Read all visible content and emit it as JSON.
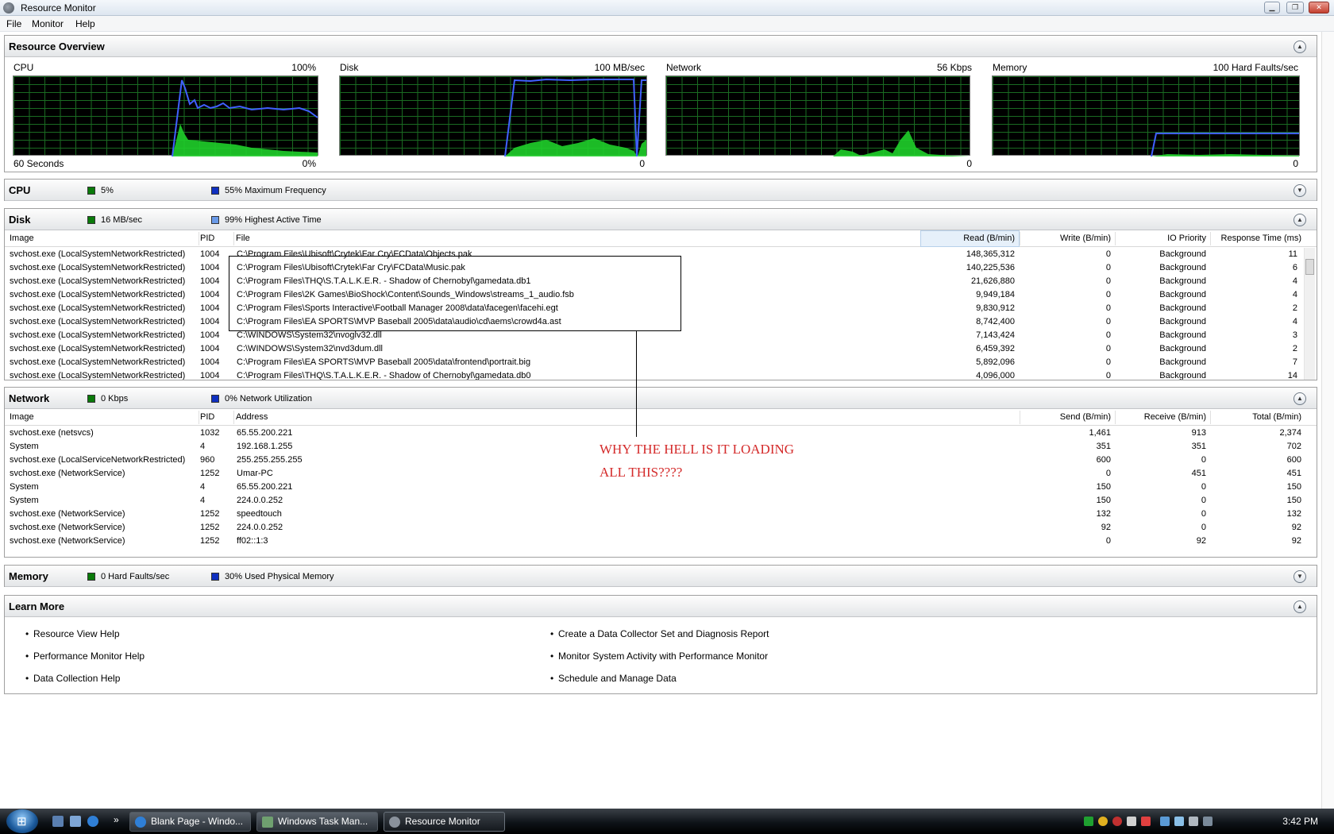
{
  "window": {
    "title": "Resource Monitor"
  },
  "menu": [
    "File",
    "Monitor",
    "Help"
  ],
  "overview": {
    "title": "Resource Overview",
    "graphs": [
      {
        "name": "CPU",
        "max": "100%",
        "min": "0%",
        "time": "60 Seconds"
      },
      {
        "name": "Disk",
        "max": "100 MB/sec",
        "min": "0"
      },
      {
        "name": "Network",
        "max": "56 Kbps",
        "min": "0"
      },
      {
        "name": "Memory",
        "max": "100 Hard Faults/sec",
        "min": "0"
      }
    ]
  },
  "cpu": {
    "title": "CPU",
    "ind1": "5%",
    "ind2": "55% Maximum Frequency"
  },
  "disk": {
    "title": "Disk",
    "ind1": "16 MB/sec",
    "ind2": "99% Highest Active Time",
    "columns": {
      "image": "Image",
      "pid": "PID",
      "file": "File",
      "read": "Read (B/min)",
      "write": "Write (B/min)",
      "io": "IO Priority",
      "resp": "Response Time (ms)"
    },
    "rows": [
      {
        "image": "svchost.exe (LocalSystemNetworkRestricted)",
        "pid": "1004",
        "file": "C:\\Program Files\\Ubisoft\\Crytek\\Far Cry\\FCData\\Objects.pak",
        "read": "148,365,312",
        "write": "0",
        "io": "Background",
        "resp": "11"
      },
      {
        "image": "svchost.exe (LocalSystemNetworkRestricted)",
        "pid": "1004",
        "file": "C:\\Program Files\\Ubisoft\\Crytek\\Far Cry\\FCData\\Music.pak",
        "read": "140,225,536",
        "write": "0",
        "io": "Background",
        "resp": "6"
      },
      {
        "image": "svchost.exe (LocalSystemNetworkRestricted)",
        "pid": "1004",
        "file": "C:\\Program Files\\THQ\\S.T.A.L.K.E.R. - Shadow of Chernobyl\\gamedata.db1",
        "read": "21,626,880",
        "write": "0",
        "io": "Background",
        "resp": "4"
      },
      {
        "image": "svchost.exe (LocalSystemNetworkRestricted)",
        "pid": "1004",
        "file": "C:\\Program Files\\2K Games\\BioShock\\Content\\Sounds_Windows\\streams_1_audio.fsb",
        "read": "9,949,184",
        "write": "0",
        "io": "Background",
        "resp": "4"
      },
      {
        "image": "svchost.exe (LocalSystemNetworkRestricted)",
        "pid": "1004",
        "file": "C:\\Program Files\\Sports Interactive\\Football Manager 2008\\data\\facegen\\facehi.egt",
        "read": "9,830,912",
        "write": "0",
        "io": "Background",
        "resp": "2"
      },
      {
        "image": "svchost.exe (LocalSystemNetworkRestricted)",
        "pid": "1004",
        "file": "C:\\Program Files\\EA SPORTS\\MVP Baseball 2005\\data\\audio\\cd\\aems\\crowd4a.ast",
        "read": "8,742,400",
        "write": "0",
        "io": "Background",
        "resp": "4"
      },
      {
        "image": "svchost.exe (LocalSystemNetworkRestricted)",
        "pid": "1004",
        "file": "C:\\WINDOWS\\System32\\nvoglv32.dll",
        "read": "7,143,424",
        "write": "0",
        "io": "Background",
        "resp": "3"
      },
      {
        "image": "svchost.exe (LocalSystemNetworkRestricted)",
        "pid": "1004",
        "file": "C:\\WINDOWS\\System32\\nvd3dum.dll",
        "read": "6,459,392",
        "write": "0",
        "io": "Background",
        "resp": "2"
      },
      {
        "image": "svchost.exe (LocalSystemNetworkRestricted)",
        "pid": "1004",
        "file": "C:\\Program Files\\EA SPORTS\\MVP Baseball 2005\\data\\frontend\\portrait.big",
        "read": "5,892,096",
        "write": "0",
        "io": "Background",
        "resp": "7"
      },
      {
        "image": "svchost.exe (LocalSystemNetworkRestricted)",
        "pid": "1004",
        "file": "C:\\Program Files\\THQ\\S.T.A.L.K.E.R. - Shadow of Chernobyl\\gamedata.db0",
        "read": "4,096,000",
        "write": "0",
        "io": "Background",
        "resp": "14"
      }
    ]
  },
  "network": {
    "title": "Network",
    "ind1": "0 Kbps",
    "ind2": "0% Network Utilization",
    "columns": {
      "image": "Image",
      "pid": "PID",
      "address": "Address",
      "send": "Send (B/min)",
      "receive": "Receive (B/min)",
      "total": "Total (B/min)"
    },
    "rows": [
      {
        "image": "svchost.exe (netsvcs)",
        "pid": "1032",
        "address": "65.55.200.221",
        "send": "1,461",
        "receive": "913",
        "total": "2,374"
      },
      {
        "image": "System",
        "pid": "4",
        "address": "192.168.1.255",
        "send": "351",
        "receive": "351",
        "total": "702"
      },
      {
        "image": "svchost.exe (LocalServiceNetworkRestricted)",
        "pid": "960",
        "address": "255.255.255.255",
        "send": "600",
        "receive": "0",
        "total": "600"
      },
      {
        "image": "svchost.exe (NetworkService)",
        "pid": "1252",
        "address": "Umar-PC",
        "send": "0",
        "receive": "451",
        "total": "451"
      },
      {
        "image": "System",
        "pid": "4",
        "address": "65.55.200.221",
        "send": "150",
        "receive": "0",
        "total": "150"
      },
      {
        "image": "System",
        "pid": "4",
        "address": "224.0.0.252",
        "send": "150",
        "receive": "0",
        "total": "150"
      },
      {
        "image": "svchost.exe (NetworkService)",
        "pid": "1252",
        "address": "speedtouch",
        "send": "132",
        "receive": "0",
        "total": "132"
      },
      {
        "image": "svchost.exe (NetworkService)",
        "pid": "1252",
        "address": "224.0.0.252",
        "send": "92",
        "receive": "0",
        "total": "92"
      },
      {
        "image": "svchost.exe (NetworkService)",
        "pid": "1252",
        "address": "ff02::1:3",
        "send": "0",
        "receive": "92",
        "total": "92"
      }
    ]
  },
  "memory": {
    "title": "Memory",
    "ind1": "0 Hard Faults/sec",
    "ind2": "30% Used Physical Memory"
  },
  "learn": {
    "title": "Learn More",
    "links": [
      "Resource View Help",
      "Performance Monitor Help",
      "Data Collection Help",
      "Create a Data Collector Set and Diagnosis Report",
      "Monitor System Activity with Performance Monitor",
      "Schedule and Manage Data"
    ]
  },
  "annotation": {
    "line1": "WHY THE HELL IS IT LOADING",
    "line2": "ALL THIS????"
  },
  "taskbar": {
    "buttons": [
      "Blank Page - Windo...",
      "Windows Task Man...",
      "Resource Monitor"
    ],
    "clock": "3:42 PM"
  },
  "colors": {
    "green": "#0a7a0a",
    "blue": "#1030c0",
    "annotation": "#d42a2a"
  }
}
